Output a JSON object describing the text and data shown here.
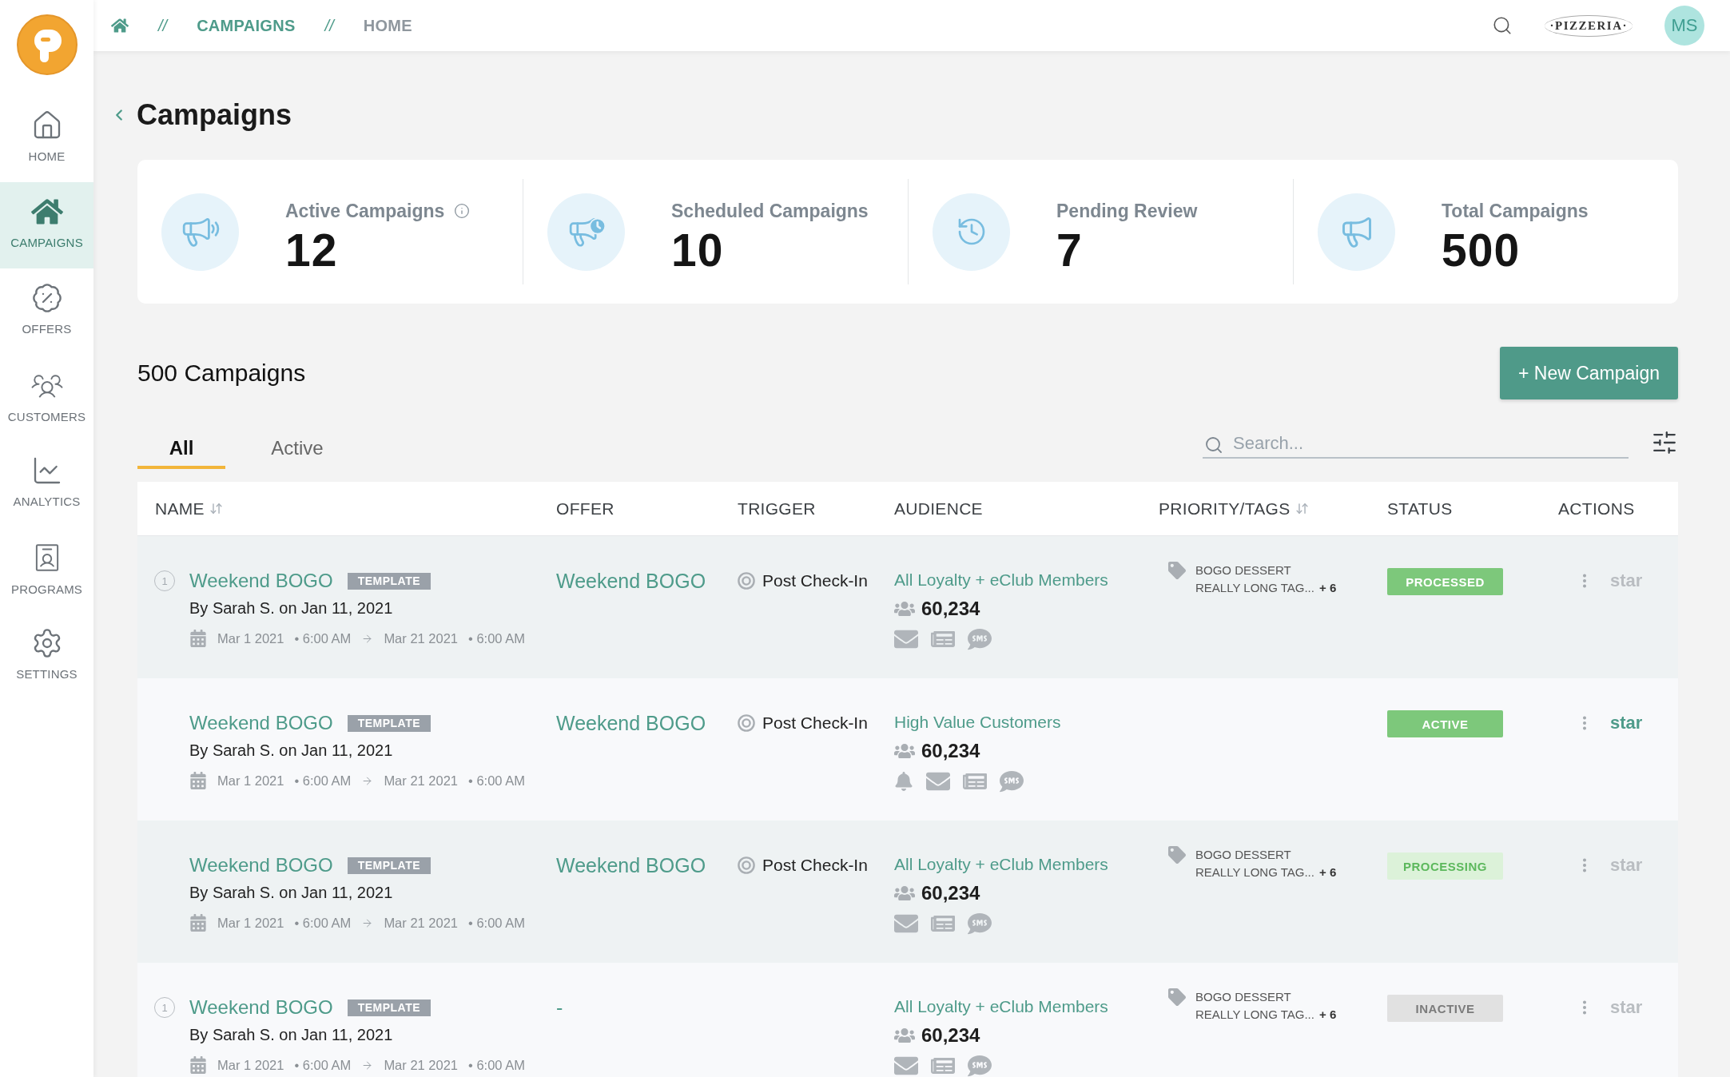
{
  "sidebar": {
    "items": [
      {
        "label": "HOME",
        "selected": false
      },
      {
        "label": "CAMPAIGNS",
        "selected": true
      },
      {
        "label": "OFFERS",
        "selected": false
      },
      {
        "label": "CUSTOMERS",
        "selected": false
      },
      {
        "label": "ANALYTICS",
        "selected": false
      },
      {
        "label": "PROGRAMS",
        "selected": false
      },
      {
        "label": "SETTINGS",
        "selected": false
      }
    ]
  },
  "header": {
    "breadcrumb": [
      {
        "separator": "//",
        "label": "CAMPAIGNS",
        "current": false
      },
      {
        "separator": "//",
        "label": "HOME",
        "current": true
      }
    ],
    "brand": "·PIZZERIA·",
    "avatar": "MS"
  },
  "page": {
    "title": "Campaigns"
  },
  "stats": [
    {
      "label": "Active Campaigns",
      "value": "12",
      "info": true
    },
    {
      "label": "Scheduled Campaigns",
      "value": "10",
      "info": false
    },
    {
      "label": "Pending Review",
      "value": "7",
      "info": false
    },
    {
      "label": "Total Campaigns",
      "value": "500",
      "info": false
    }
  ],
  "list": {
    "title": "500 Campaigns",
    "new_button": "+ New Campaign",
    "tabs": [
      {
        "label": "All",
        "selected": true
      },
      {
        "label": "Active",
        "selected": false
      }
    ],
    "search": {
      "placeholder": "Search..."
    }
  },
  "table": {
    "columns": [
      {
        "label": "NAME",
        "sortable": true
      },
      {
        "label": "OFFER",
        "sortable": false
      },
      {
        "label": "TRIGGER",
        "sortable": false
      },
      {
        "label": "AUDIENCE",
        "sortable": false
      },
      {
        "label": "PRIORITY/TAGS",
        "sortable": true
      },
      {
        "label": "STATUS",
        "sortable": false
      },
      {
        "label": "ACTIONS",
        "sortable": false
      }
    ],
    "rows": [
      {
        "priority": "1",
        "name": "Weekend BOGO",
        "badge": "TEMPLATE",
        "created": "By Sarah S. on Jan 11, 2021",
        "start_date": "Mar 1 2021",
        "start_time": "• 6:00 AM",
        "end_date": "Mar 21 2021",
        "end_time": "• 6:00 AM",
        "offer": "Weekend BOGO",
        "trigger": "Post Check-In",
        "audience": "All Loyalty + eClub Members",
        "audience_count": "60,234",
        "channels": [
          {
            "kind": "email"
          },
          {
            "kind": "newsletter"
          },
          {
            "kind": "sms"
          }
        ],
        "tags": [
          "BOGO DESSERT",
          "REALLY LONG TAG..."
        ],
        "tags_more": "+ 6",
        "status": {
          "label": "PROCESSED",
          "kind": "processed"
        },
        "action": "star",
        "starred": false
      },
      {
        "name": "Weekend BOGO",
        "badge": "TEMPLATE",
        "created": "By Sarah S. on Jan 11, 2021",
        "start_date": "Mar 1 2021",
        "start_time": "• 6:00 AM",
        "end_date": "Mar 21 2021",
        "end_time": "• 6:00 AM",
        "offer": "Weekend BOGO",
        "trigger": "Post Check-In",
        "audience": "High Value Customers",
        "audience_count": "60,234",
        "channels": [
          {
            "kind": "notification"
          },
          {
            "kind": "email"
          },
          {
            "kind": "newsletter"
          },
          {
            "kind": "sms"
          }
        ],
        "status": {
          "label": "ACTIVE",
          "kind": "active"
        },
        "action": "star",
        "starred": true
      },
      {
        "name": "Weekend BOGO",
        "badge": "TEMPLATE",
        "created": "By Sarah S. on Jan 11, 2021",
        "start_date": "Mar 1 2021",
        "start_time": "• 6:00 AM",
        "end_date": "Mar 21 2021",
        "end_time": "• 6:00 AM",
        "offer": "Weekend BOGO",
        "trigger": "Post Check-In",
        "audience": "All Loyalty + eClub Members",
        "audience_count": "60,234",
        "channels": [
          {
            "kind": "email"
          },
          {
            "kind": "newsletter"
          },
          {
            "kind": "sms"
          }
        ],
        "tags": [
          "BOGO DESSERT",
          "REALLY LONG TAG..."
        ],
        "tags_more": "+ 6",
        "status": {
          "label": "PROCESSING",
          "kind": "processing"
        },
        "action": "star",
        "starred": false
      },
      {
        "priority": "1",
        "name": "Weekend BOGO",
        "badge": "TEMPLATE",
        "created": "By Sarah S. on Jan 11, 2021",
        "start_date": "Mar 1 2021",
        "start_time": "• 6:00 AM",
        "end_date": "Mar 21 2021",
        "end_time": "• 6:00 AM",
        "offer": "-",
        "audience": "All Loyalty + eClub Members",
        "audience_count": "60,234",
        "channels": [
          {
            "kind": "email"
          },
          {
            "kind": "newsletter"
          },
          {
            "kind": "sms"
          }
        ],
        "tags": [
          "BOGO DESSERT",
          "REALLY LONG TAG..."
        ],
        "tags_more": "+ 6",
        "status": {
          "label": "INACTIVE",
          "kind": "inactive"
        },
        "action": "star",
        "starred": false
      }
    ]
  }
}
